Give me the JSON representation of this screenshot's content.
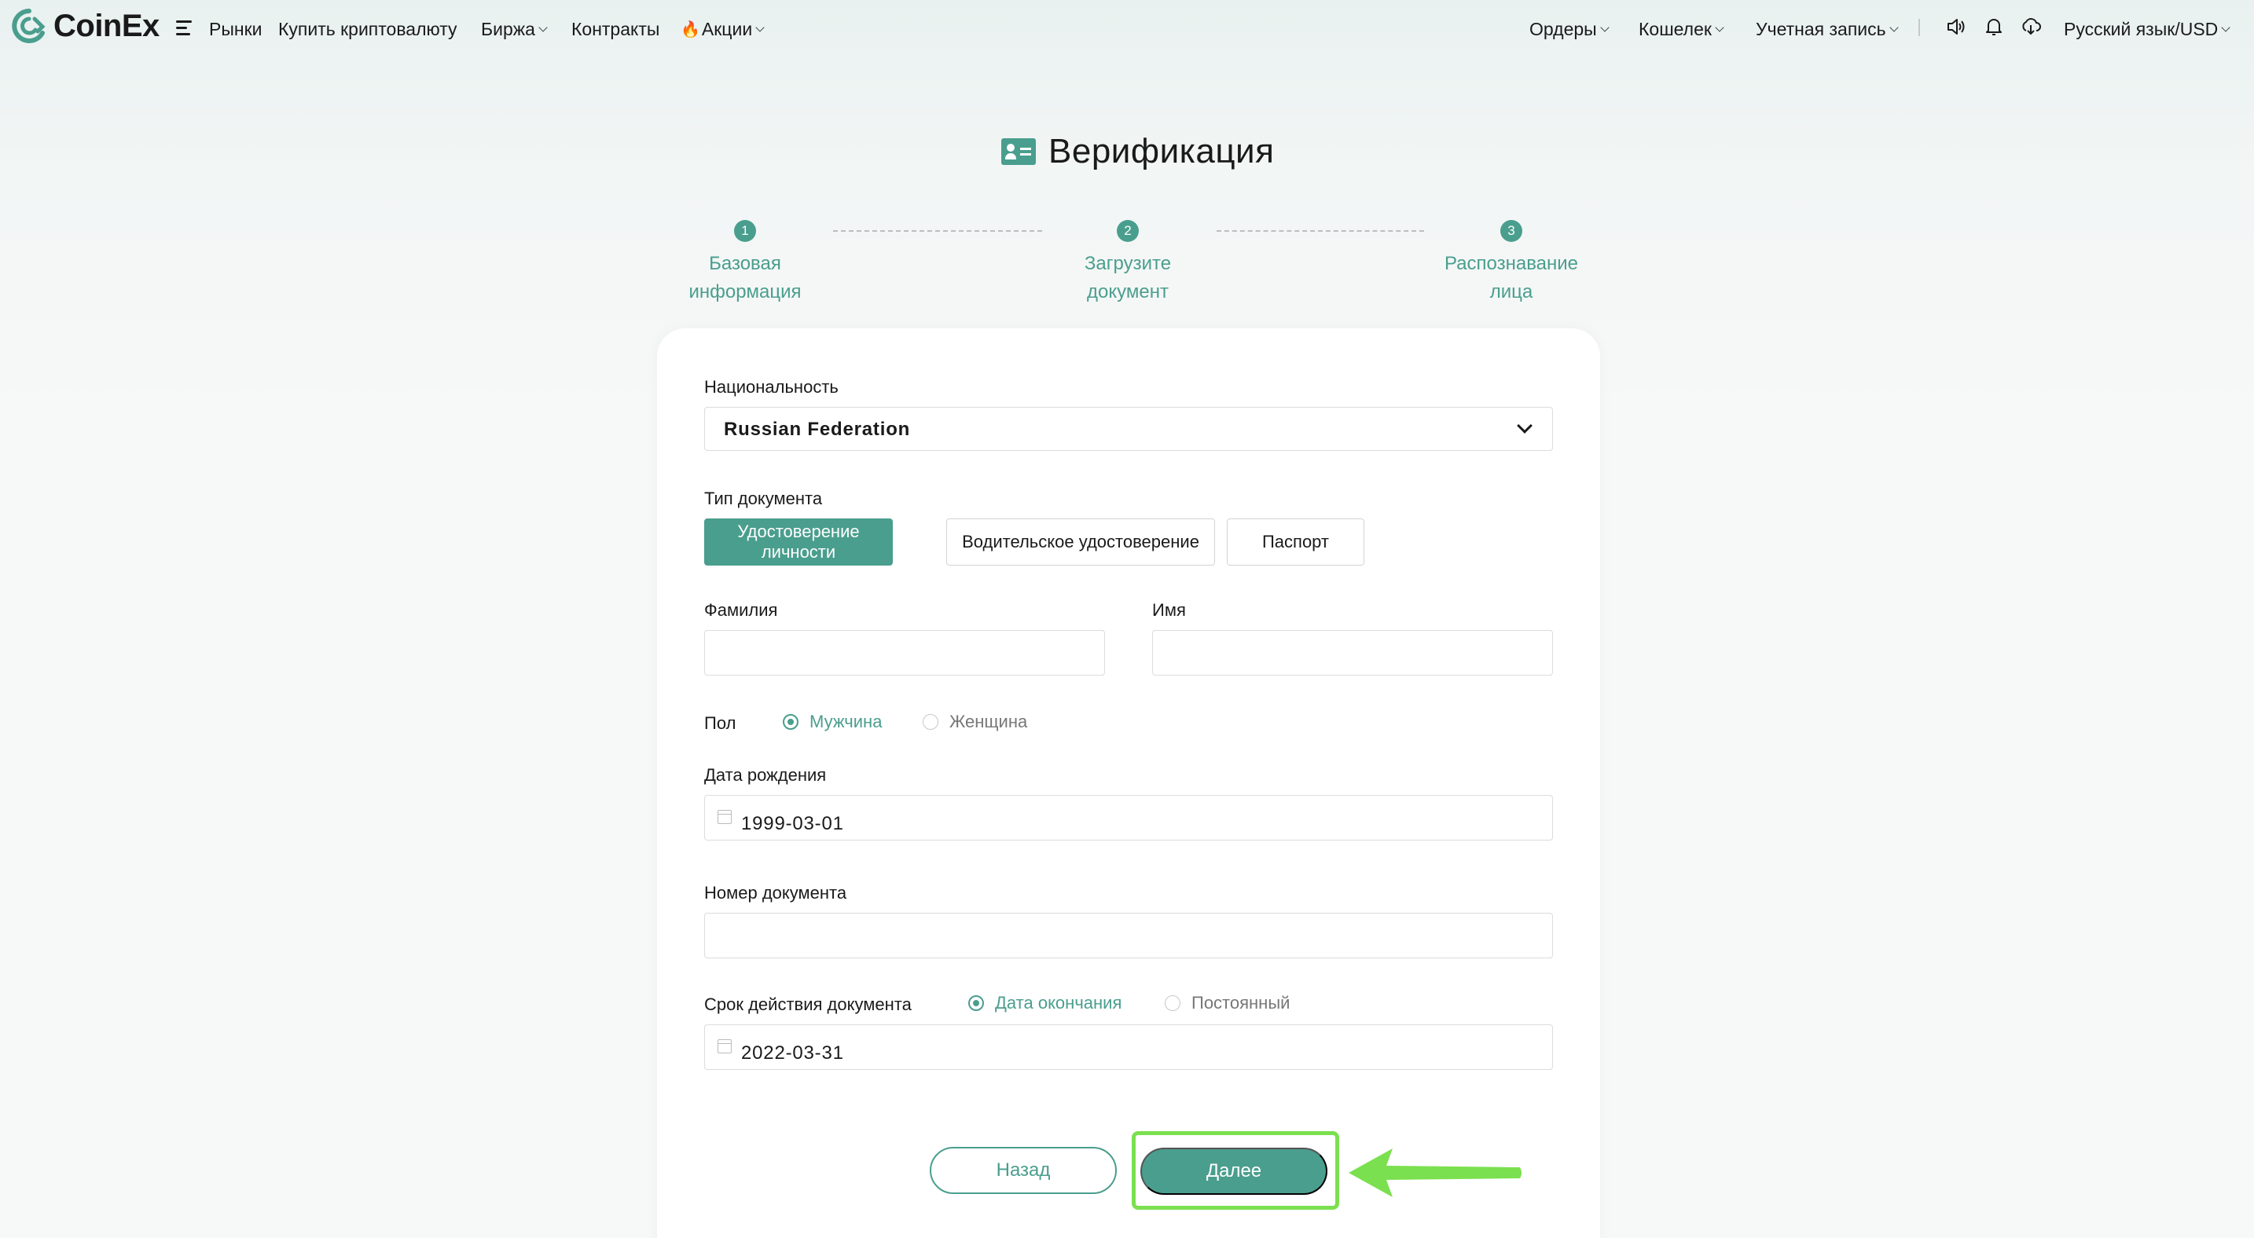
{
  "header": {
    "logo_text": "CoinEx",
    "nav": [
      {
        "label": "Рынки",
        "dropdown": false
      },
      {
        "label": "Купить криптовалюту",
        "dropdown": false
      },
      {
        "label": "Биржа",
        "dropdown": true
      },
      {
        "label": "Контракты",
        "dropdown": false
      },
      {
        "label": "Акции",
        "dropdown": true,
        "icon": "flame-icon"
      }
    ],
    "right_nav": [
      {
        "label": "Ордеры"
      },
      {
        "label": "Кошелек"
      },
      {
        "label": "Учетная запись"
      }
    ],
    "language": "Русский язык/USD",
    "icons": [
      "speaker-icon",
      "bell-icon",
      "download-icon"
    ]
  },
  "page": {
    "title": "Верификация",
    "steps": [
      {
        "num": "1",
        "label": "Базовая\nинформация"
      },
      {
        "num": "2",
        "label": "Загрузите\nдокумент"
      },
      {
        "num": "3",
        "label": "Распознавание\nлица"
      }
    ]
  },
  "form": {
    "nationality_label": "Национальность",
    "nationality_value": "Russian Federation",
    "doc_type_label": "Тип документа",
    "doc_types": [
      "Удостоверение личности",
      "Водительское удостоверение",
      "Паспорт"
    ],
    "doc_type_selected": "Удостоверение личности",
    "surname_label": "Фамилия",
    "surname_value": "",
    "name_label": "Имя",
    "name_value": "",
    "gender_label": "Пол",
    "gender_options": [
      "Мужчина",
      "Женщина"
    ],
    "gender_selected": "Мужчина",
    "birthdate_label": "Дата рождения",
    "birthdate_value": "1999-03-01",
    "doc_number_label": "Номер документа",
    "doc_number_value": "",
    "validity_label": "Срок действия документа",
    "validity_options": [
      "Дата окончания",
      "Постоянный"
    ],
    "validity_selected": "Дата окончания",
    "expiry_value": "2022-03-31",
    "back_button": "Назад",
    "next_button": "Далее"
  },
  "colors": {
    "accent": "#4a9e8e",
    "highlight": "#7be04f"
  }
}
